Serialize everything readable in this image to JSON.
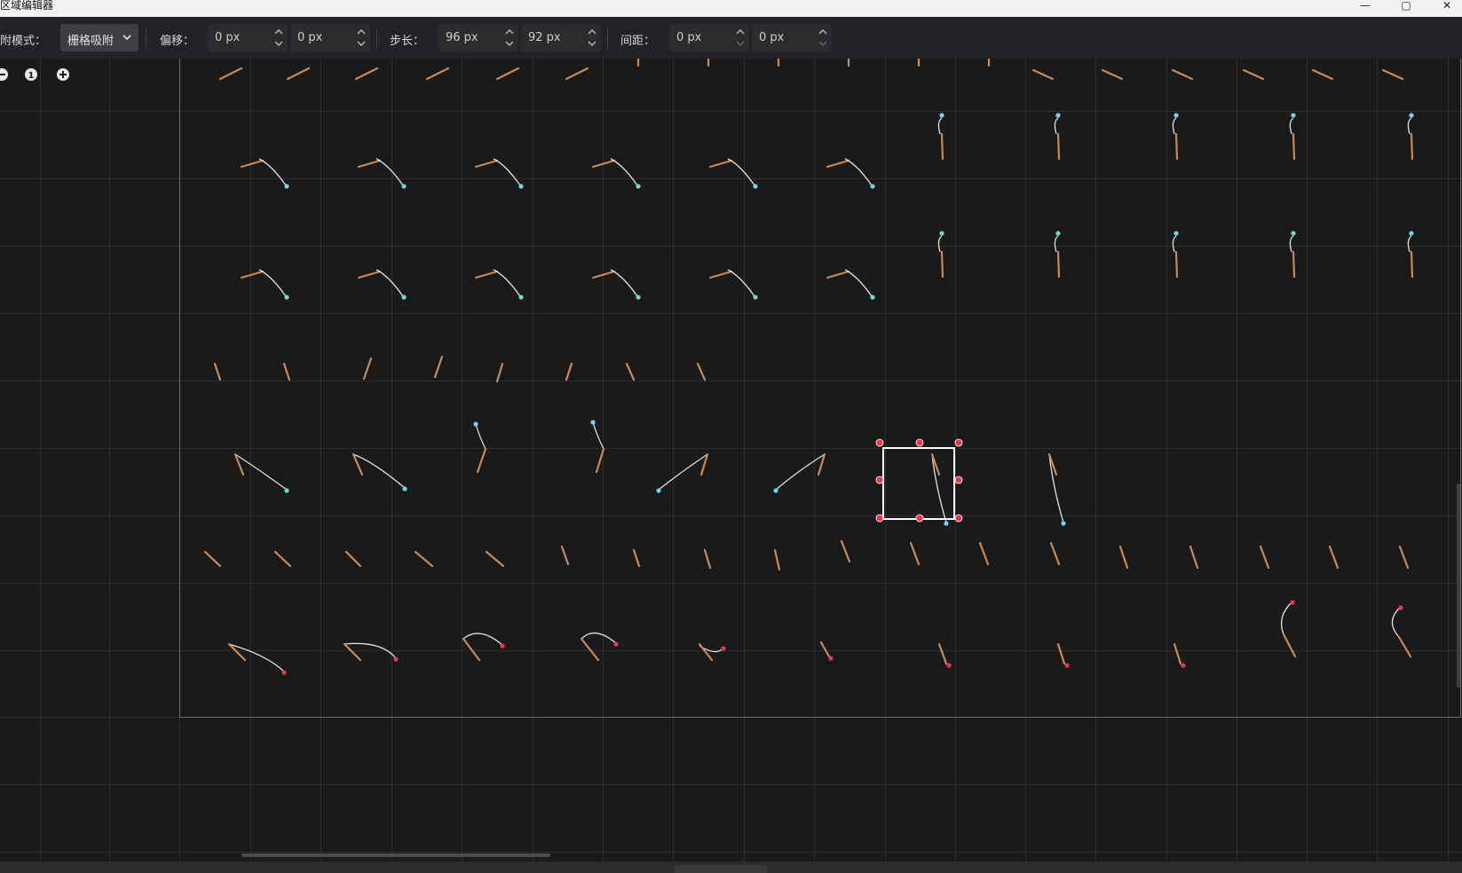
{
  "window": {
    "title": "区域编辑器",
    "minimize_glyph": "—",
    "maximize_glyph": "▢",
    "close_glyph": "✕"
  },
  "toolbar": {
    "snap_mode_label": "附模式：",
    "snap_mode_value": "栅格吸附",
    "offset_label": "偏移：",
    "offset_x": "0 px",
    "offset_y": "0 px",
    "step_label": "步长：",
    "step_x": "96 px",
    "step_y": "92 px",
    "spacing_label": "间距：",
    "spacing_x": "0 px",
    "spacing_y": "0 px"
  },
  "canvas_tools": {
    "zoom_reset_label": "1",
    "icons": [
      "zoom-out-icon",
      "zoom-reset-icon",
      "zoom-in-icon"
    ]
  },
  "colors": {
    "background": "#1a1a1b",
    "toolbar": "#222326",
    "grid_line": "#2e2e30",
    "region_border": "#6a6a6a",
    "selection_outline": "#ffffff",
    "selection_handle": "#e8394a",
    "sprite_wood": "#c98a5a",
    "sprite_line": "#e0e0e0",
    "sprite_hook": "#6fd6e6"
  }
}
